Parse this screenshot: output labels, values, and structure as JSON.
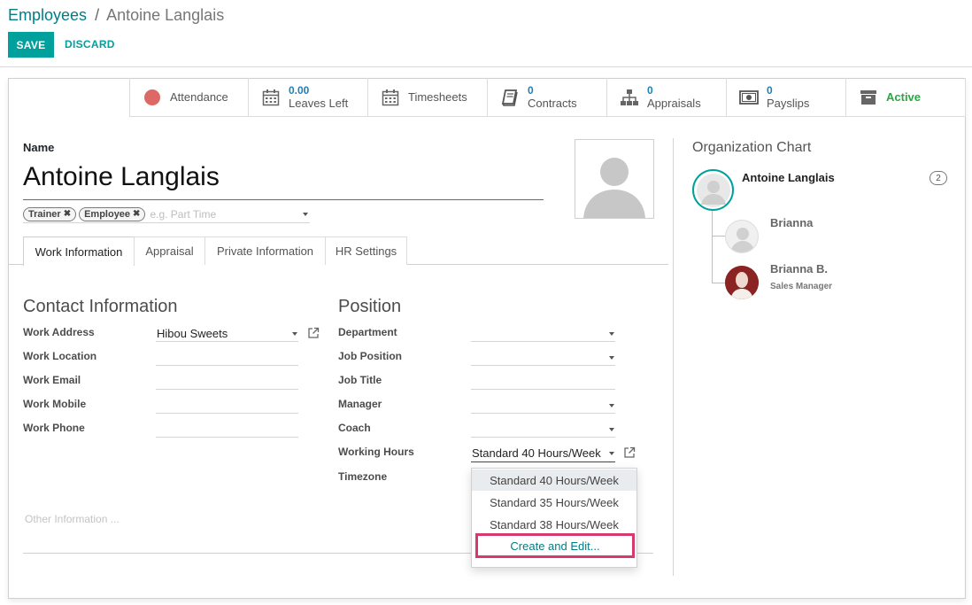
{
  "breadcrumb": {
    "parent": "Employees",
    "separator": "/",
    "current": "Antoine Langlais"
  },
  "actions": {
    "save": "SAVE",
    "discard": "DISCARD"
  },
  "smart_buttons": {
    "attendance": "Attendance",
    "leaves": {
      "value": "0.00",
      "label": "Leaves Left"
    },
    "timesheets": "Timesheets",
    "contracts": {
      "value": "0",
      "label": "Contracts"
    },
    "appraisals": {
      "value": "0",
      "label": "Appraisals"
    },
    "payslips": {
      "value": "0",
      "label": "Payslips"
    },
    "active": "Active"
  },
  "employee": {
    "name_label": "Name",
    "name": "Antoine Langlais",
    "tags": [
      "Trainer",
      "Employee"
    ],
    "tags_placeholder": "e.g. Part Time"
  },
  "tabs": [
    "Work Information",
    "Appraisal",
    "Private Information",
    "HR Settings"
  ],
  "contact": {
    "title": "Contact Information",
    "fields": [
      {
        "label": "Work Address",
        "value": "Hibou Sweets"
      },
      {
        "label": "Work Location",
        "value": ""
      },
      {
        "label": "Work Email",
        "value": ""
      },
      {
        "label": "Work Mobile",
        "value": ""
      },
      {
        "label": "Work Phone",
        "value": ""
      }
    ]
  },
  "position": {
    "title": "Position",
    "fields": [
      {
        "label": "Department",
        "value": ""
      },
      {
        "label": "Job Position",
        "value": ""
      },
      {
        "label": "Job Title",
        "value": ""
      },
      {
        "label": "Manager",
        "value": ""
      },
      {
        "label": "Coach",
        "value": ""
      },
      {
        "label": "Working Hours",
        "value": "Standard 40 Hours/Week"
      },
      {
        "label": "Timezone",
        "value": ""
      }
    ]
  },
  "working_hours_dropdown": {
    "options": [
      "Standard 40 Hours/Week",
      "Standard 35 Hours/Week",
      "Standard 38 Hours/Week"
    ],
    "create": "Create and Edit..."
  },
  "other_information_placeholder": "Other Information ...",
  "org_chart": {
    "title": "Organization Chart",
    "main": {
      "name": "Antoine Langlais",
      "count": "2"
    },
    "children": [
      {
        "name": "Brianna",
        "role": ""
      },
      {
        "name": "Brianna B.",
        "role": "Sales Manager"
      }
    ]
  },
  "colors": {
    "accent": "#00a09d",
    "link": "#017e84",
    "value_blue": "#1e7fb6",
    "active_green": "#28a745",
    "highlight": "#d63a6c"
  }
}
